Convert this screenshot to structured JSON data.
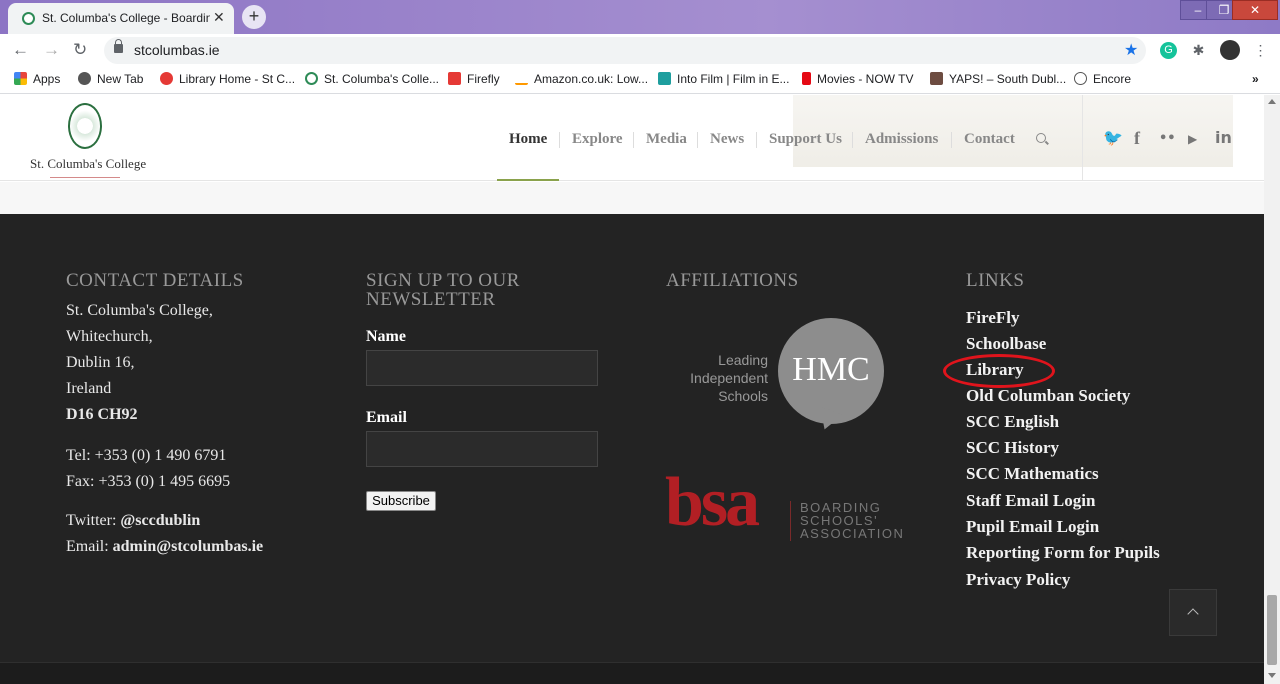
{
  "browser": {
    "tab_title": "St. Columba's College - Boarding",
    "close_glyph": "✕",
    "new_tab_glyph": "+",
    "url": "stcolumbas.ie",
    "window_controls": {
      "minimize": "–",
      "maximize": "❐",
      "close": "✕"
    },
    "nav": {
      "back": "←",
      "forward": "→",
      "reload": "↻"
    },
    "star": "★",
    "bookmarks": [
      {
        "label": "Apps",
        "icon": "apps-grid-icon",
        "color": "#e8453c"
      },
      {
        "label": "New Tab",
        "icon": "globe-icon",
        "color": "#555555"
      },
      {
        "label": "Library Home - St C...",
        "icon": "library-icon",
        "color": "#e53935"
      },
      {
        "label": "St. Columba's Colle...",
        "icon": "crest-icon",
        "color": "#2e8b57"
      },
      {
        "label": "Firefly",
        "icon": "firefly-icon",
        "color": "#e53935"
      },
      {
        "label": "Amazon.co.uk: Low...",
        "icon": "amazon-icon",
        "color": "#222222"
      },
      {
        "label": "Into Film | Film in E...",
        "icon": "into-film-icon",
        "color": "#1e9e9e"
      },
      {
        "label": "Movies - NOW TV",
        "icon": "netflix-n-icon",
        "color": "#e50914"
      },
      {
        "label": "YAPS! – South Dubl...",
        "icon": "yaps-icon",
        "color": "#6d4c41"
      },
      {
        "label": "Encore",
        "icon": "play-circle-icon",
        "color": "#555555"
      }
    ],
    "more_bookmarks": "»"
  },
  "site": {
    "logo_text": "St. Columba's College",
    "menu": [
      "Home",
      "Explore",
      "Media",
      "News",
      "Support Us",
      "Admissions",
      "Contact"
    ],
    "social": {
      "twitter": "🐦",
      "facebook": "f",
      "flickr": "••",
      "youtube": "▶",
      "linkedin": "in"
    }
  },
  "footer": {
    "contact": {
      "heading": "CONTACT DETAILS",
      "address": [
        "St. Columba's College,",
        "Whitechurch,",
        "Dublin 16,",
        "Ireland"
      ],
      "eircode": "D16 CH92",
      "tel": "Tel: +353 (0) 1 490 6791",
      "fax": "Fax: +353 (0) 1 495 6695",
      "twitter_label": "Twitter: ",
      "twitter_handle": "@sccdublin",
      "email_label": "Email: ",
      "email": "admin@stcolumbas.ie"
    },
    "newsletter": {
      "heading_line1": "SIGN UP TO OUR",
      "heading_line2": "NEWSLETTER",
      "name_label": "Name",
      "email_label": "Email",
      "subscribe_label": "Subscribe",
      "name_value": "",
      "email_value": ""
    },
    "affiliations": {
      "heading": "AFFILIATIONS",
      "hmc_text": [
        "Leading",
        "Independent",
        "Schools"
      ],
      "hmc_logo": "HMC",
      "bsa_logo": "bsa",
      "bsa_text": [
        "BOARDING",
        "SCHOOLS'",
        "ASSOCIATION"
      ]
    },
    "links": {
      "heading": "LINKS",
      "items": [
        "FireFly",
        "Schoolbase",
        "Library",
        "Old Columban Society",
        "SCC English",
        "SCC History",
        "SCC Mathematics",
        "Staff Email Login",
        "Pupil Email Login",
        "Reporting Form for Pupils",
        "Privacy Policy"
      ],
      "highlighted": "Library",
      "highlight_color": "#e0141c"
    }
  }
}
